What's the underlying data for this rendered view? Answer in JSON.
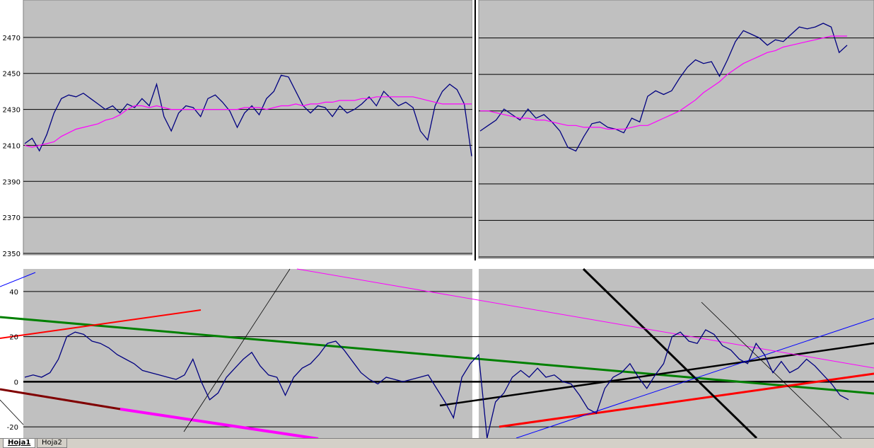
{
  "chart_data": [
    {
      "type": "line",
      "panel": "top-left",
      "ylim": [
        2350,
        2490
      ],
      "yticks": [
        2350,
        2370,
        2390,
        2410,
        2430,
        2450,
        2470
      ],
      "xticks": [
        "1",
        "784",
        "1567",
        "2350",
        "3133",
        "3916",
        "4699",
        "5482",
        "6265",
        "7048",
        "7831",
        "8614",
        "9397",
        "10180",
        "10963",
        "11746",
        "12529",
        "13312",
        "14095",
        "14878",
        "15661",
        "16444",
        "17227",
        "18010",
        "18793",
        "19576",
        "20359",
        "21142",
        "21925",
        "22708",
        "23491",
        "24274",
        "25057",
        "25840",
        "26623",
        "27406",
        "28189",
        "28972"
      ],
      "series": [
        {
          "color": "#000080",
          "values": [
            2411,
            2414,
            2407,
            2416,
            2428,
            2436,
            2438,
            2437,
            2439,
            2436,
            2433,
            2430,
            2432,
            2428,
            2433,
            2431,
            2436,
            2432,
            2444,
            2426,
            2418,
            2428,
            2432,
            2431,
            2426,
            2436,
            2438,
            2434,
            2429,
            2420,
            2428,
            2432,
            2427,
            2436,
            2440,
            2449,
            2448,
            2440,
            2432,
            2428,
            2432,
            2431,
            2426,
            2432,
            2428,
            2430,
            2433,
            2437,
            2432,
            2440,
            2436,
            2432,
            2434,
            2431,
            2418,
            2413,
            2432,
            2440,
            2444,
            2441,
            2433,
            2404
          ]
        },
        {
          "color": "#ff00ff",
          "values": [
            2410,
            2409,
            2410,
            2411,
            2412,
            2415,
            2417,
            2419,
            2420,
            2421,
            2422,
            2424,
            2425,
            2427,
            2430,
            2432,
            2432,
            2431,
            2432,
            2431,
            2430,
            2430,
            2430,
            2430,
            2430,
            2430,
            2430,
            2430,
            2430,
            2430,
            2431,
            2431,
            2431,
            2430,
            2431,
            2432,
            2432,
            2433,
            2432,
            2433,
            2433,
            2434,
            2434,
            2435,
            2435,
            2435,
            2436,
            2436,
            2437,
            2437,
            2437,
            2437,
            2437,
            2437,
            2436,
            2435,
            2434,
            2433,
            2433,
            2433,
            2433,
            2433
          ]
        }
      ]
    },
    {
      "type": "line",
      "panel": "top-right",
      "ylim": [
        2350,
        2490
      ],
      "yticks": [
        2350,
        2370,
        2390,
        2410,
        2430,
        2450,
        2470
      ],
      "xticks": [
        "1",
        "786",
        "1575",
        "2363",
        "3151",
        "3938",
        "4726",
        "5513",
        "6301",
        "7088",
        "7876",
        "8663",
        "9451",
        "10238",
        "11026",
        "11813",
        "12600",
        "13388",
        "14175",
        "14963",
        "15750",
        "16538",
        "17325",
        "18113",
        "18900",
        "19688",
        "20475",
        "21263",
        "22050",
        "22838",
        "23625",
        "24413",
        "25200",
        "25988",
        "26775",
        "27563",
        "28350"
      ],
      "series": [
        {
          "color": "#000080",
          "values": [
            2419,
            2422,
            2425,
            2431,
            2428,
            2425,
            2431,
            2426,
            2428,
            2424,
            2419,
            2410,
            2408,
            2416,
            2423,
            2424,
            2421,
            2420,
            2418,
            2426,
            2424,
            2438,
            2441,
            2439,
            2441,
            2448,
            2454,
            2458,
            2456,
            2457,
            2449,
            2458,
            2468,
            2474,
            2472,
            2470,
            2466,
            2469,
            2468,
            2472,
            2476,
            2475,
            2476,
            2478,
            2476,
            2462,
            2466
          ]
        },
        {
          "color": "#ff00ff",
          "values": [
            2430,
            2430,
            2429,
            2428,
            2427,
            2426,
            2426,
            2425,
            2425,
            2424,
            2423,
            2422,
            2422,
            2421,
            2421,
            2421,
            2420,
            2420,
            2420,
            2421,
            2422,
            2422,
            2424,
            2426,
            2428,
            2430,
            2433,
            2436,
            2440,
            2443,
            2446,
            2450,
            2453,
            2456,
            2458,
            2460,
            2462,
            2463,
            2465,
            2466,
            2467,
            2468,
            2469,
            2470,
            2471,
            2471,
            2471
          ]
        }
      ]
    },
    {
      "type": "line",
      "panel": "bottom",
      "ylim": [
        -25,
        50
      ],
      "yticks": [
        -20,
        0,
        20,
        40
      ],
      "series": [
        {
          "color": "#000080",
          "values": [
            2,
            3,
            2,
            4,
            10,
            20,
            22,
            21,
            18,
            17,
            15,
            12,
            10,
            8,
            5,
            4,
            3,
            2,
            1,
            3,
            10,
            0,
            -8,
            -5,
            2,
            6,
            10,
            13,
            7,
            3,
            2,
            -6,
            2,
            6,
            8,
            12,
            17,
            18,
            14,
            9,
            4,
            1,
            -1,
            2,
            1,
            0,
            1,
            2,
            3,
            -3,
            -9,
            -16,
            2,
            8,
            12,
            -25,
            -9,
            -5,
            2,
            5,
            2,
            6,
            2,
            3,
            0,
            -1,
            -6,
            -12,
            -14,
            -3,
            2,
            4,
            8,
            2,
            -3,
            3,
            8,
            20,
            22,
            18,
            17,
            23,
            21,
            16,
            14,
            10,
            8,
            17,
            12,
            4,
            9,
            4,
            6,
            10,
            7,
            3,
            -1,
            -6,
            -8
          ]
        }
      ]
    }
  ],
  "sheet_tabs": {
    "tab1": "Hoja1",
    "tab2": "Hoja2"
  }
}
